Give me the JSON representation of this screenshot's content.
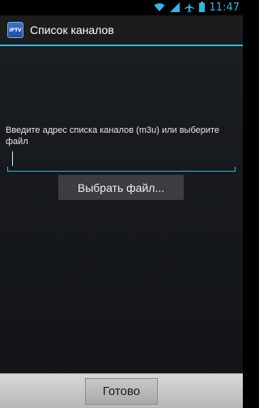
{
  "status_bar": {
    "time": "11:47",
    "icons": [
      "wifi-icon",
      "signal-icon",
      "airplane-icon",
      "battery-icon"
    ]
  },
  "action_bar": {
    "app_icon_text": "IPTV",
    "title": "Список каналов"
  },
  "main": {
    "prompt": "Введите адрес списка каналов (m3u) или выберите файл",
    "url_value": "",
    "choose_file_label": "Выбрать файл..."
  },
  "footer": {
    "done_label": "Готово"
  },
  "colors": {
    "accent": "#33b5e5",
    "background": "#121417"
  }
}
